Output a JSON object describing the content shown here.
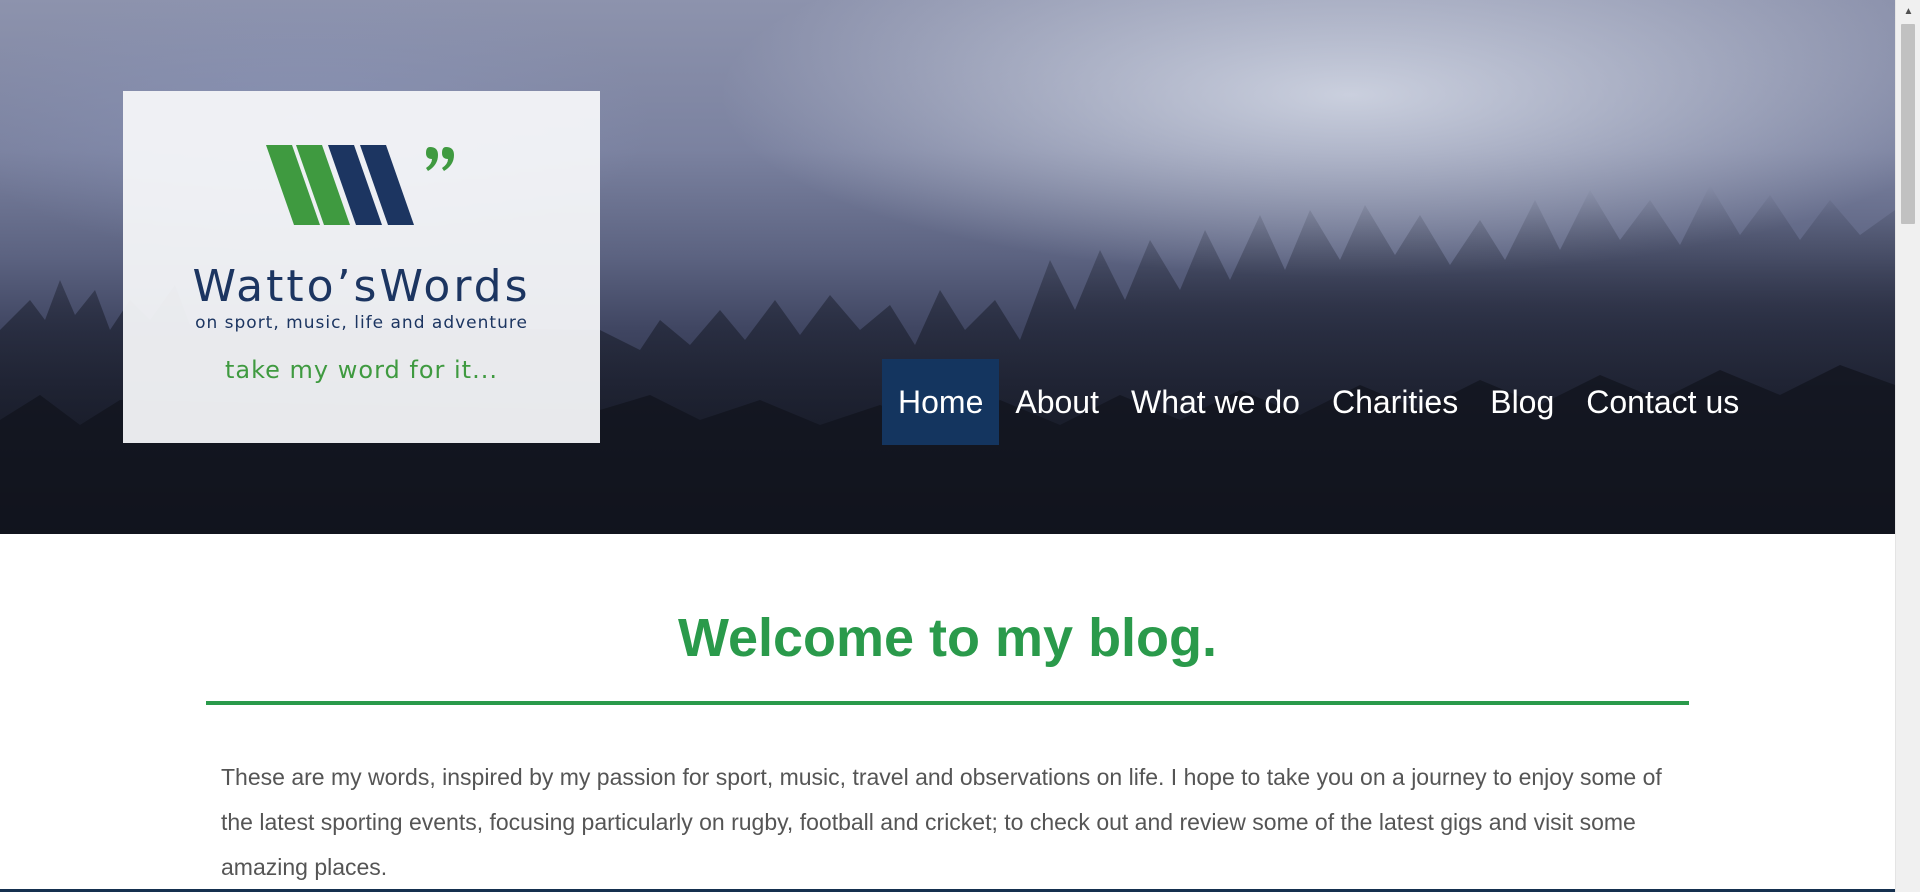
{
  "logo": {
    "title": "Watto’sWords",
    "subtitle": "on sport, music, life and adventure",
    "tagline": "take my word for it...",
    "colors": {
      "green": "#3f9a40",
      "navy": "#1c3561"
    }
  },
  "nav": {
    "active": "Home",
    "items": [
      "Home",
      "About",
      "What we do",
      "Charities",
      "Blog",
      "Contact us"
    ]
  },
  "main": {
    "heading": "Welcome to my blog.",
    "intro": "These are my words, inspired by my passion for sport, music, travel and observations on life. I hope to take you on a journey to enjoy some of the latest sporting events, focusing particularly on rugby, football and cricket; to check out and review some of the latest gigs and visit some amazing places."
  },
  "colors": {
    "accent_green": "#2a9a4b",
    "nav_active_bg": "#14355f",
    "body_text": "#555555"
  },
  "icons": {
    "scroll_up": "▲"
  }
}
